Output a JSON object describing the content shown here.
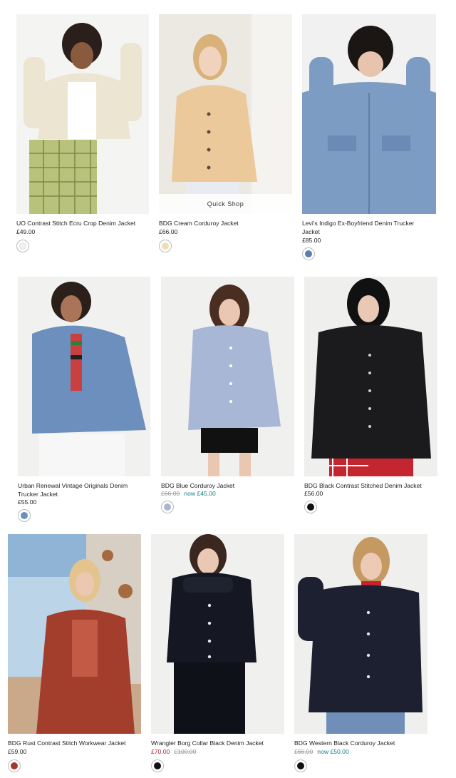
{
  "quick_shop_label": "Quick Shop",
  "products": [
    {
      "name": "UO Contrast Stitch Ecru Crop Denim Jacket",
      "price": "£49.00",
      "was": "",
      "now": "",
      "swatch": "#f3f1ea"
    },
    {
      "name": "BDG Cream Corduroy Jacket",
      "price": "£66.00",
      "was": "",
      "now": "",
      "swatch": "#f1dcb8"
    },
    {
      "name": "Levi's Indigo Ex-Boyfriend Denim Trucker Jacket",
      "price": "£85.00",
      "was": "",
      "now": "",
      "swatch": "#5b7fb0"
    },
    {
      "name": "Urban Renewal Vintage Originals Denim Trucker Jacket",
      "price": "£55.00",
      "was": "",
      "now": "",
      "swatch": "#6d8fbf"
    },
    {
      "name": "BDG Blue Corduroy Jacket",
      "price": "",
      "was": "£66.00",
      "now": "now £45.00",
      "swatch": "#a9b7d6"
    },
    {
      "name": "BDG Black Contrast Stitched Denim Jacket",
      "price": "£56.00",
      "was": "",
      "now": "",
      "swatch": "#111111"
    },
    {
      "name": "BDG Rust Contrast Stitch Workwear Jacket",
      "price": "£59.00",
      "was": "",
      "now": "",
      "swatch": "#a03a2c"
    },
    {
      "name": "Wrangler Borg Collar Black Denim Jacket",
      "price": "",
      "was": "£100.00",
      "now": "£70.00",
      "swatch": "#111111"
    },
    {
      "name": "BDG Western Black Corduroy Jacket",
      "price": "",
      "was": "£66.00",
      "now": "now £50.00",
      "swatch": "#111111"
    }
  ]
}
